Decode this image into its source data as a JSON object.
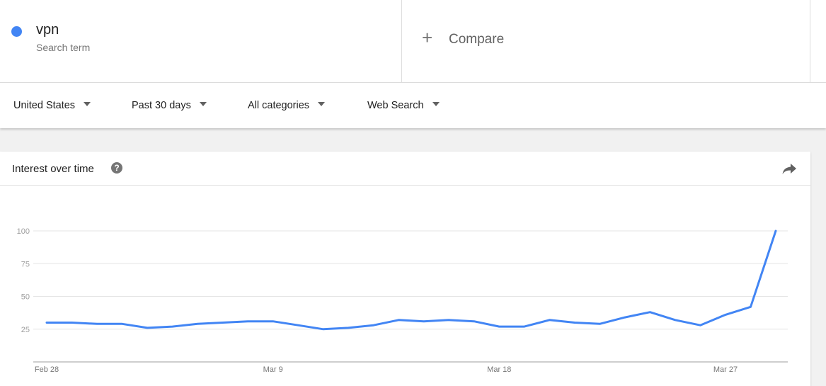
{
  "term": {
    "name": "vpn",
    "subtitle": "Search term",
    "color": "#4285f4"
  },
  "compare": {
    "icon": "plus-icon",
    "label": "Compare"
  },
  "filters": [
    {
      "label": "United States"
    },
    {
      "label": "Past 30 days"
    },
    {
      "label": "All categories"
    },
    {
      "label": "Web Search"
    }
  ],
  "card": {
    "title": "Interest over time",
    "help_icon": "help-icon",
    "share_icon": "share-icon"
  },
  "chart_data": {
    "type": "line",
    "x": [
      "Feb 28",
      "Mar 1",
      "Mar 2",
      "Mar 3",
      "Mar 4",
      "Mar 5",
      "Mar 6",
      "Mar 7",
      "Mar 8",
      "Mar 9",
      "Mar 10",
      "Mar 11",
      "Mar 12",
      "Mar 13",
      "Mar 14",
      "Mar 15",
      "Mar 16",
      "Mar 17",
      "Mar 18",
      "Mar 19",
      "Mar 20",
      "Mar 21",
      "Mar 22",
      "Mar 23",
      "Mar 24",
      "Mar 25",
      "Mar 26",
      "Mar 27",
      "Mar 28",
      "Mar 29"
    ],
    "x_tick_labels": [
      "Feb 28",
      "Mar 9",
      "Mar 18",
      "Mar 27"
    ],
    "series": [
      {
        "values": [
          30,
          30,
          29,
          29,
          26,
          27,
          29,
          30,
          31,
          31,
          28,
          25,
          26,
          28,
          32,
          31,
          32,
          31,
          27,
          27,
          32,
          30,
          29,
          34,
          38,
          32,
          28,
          36,
          42,
          100
        ],
        "color": "#4285f4"
      }
    ],
    "y_ticks": [
      25,
      50,
      75,
      100
    ],
    "ylim": [
      0,
      100
    ],
    "grid": true,
    "title": "",
    "xlabel": "",
    "ylabel": ""
  }
}
